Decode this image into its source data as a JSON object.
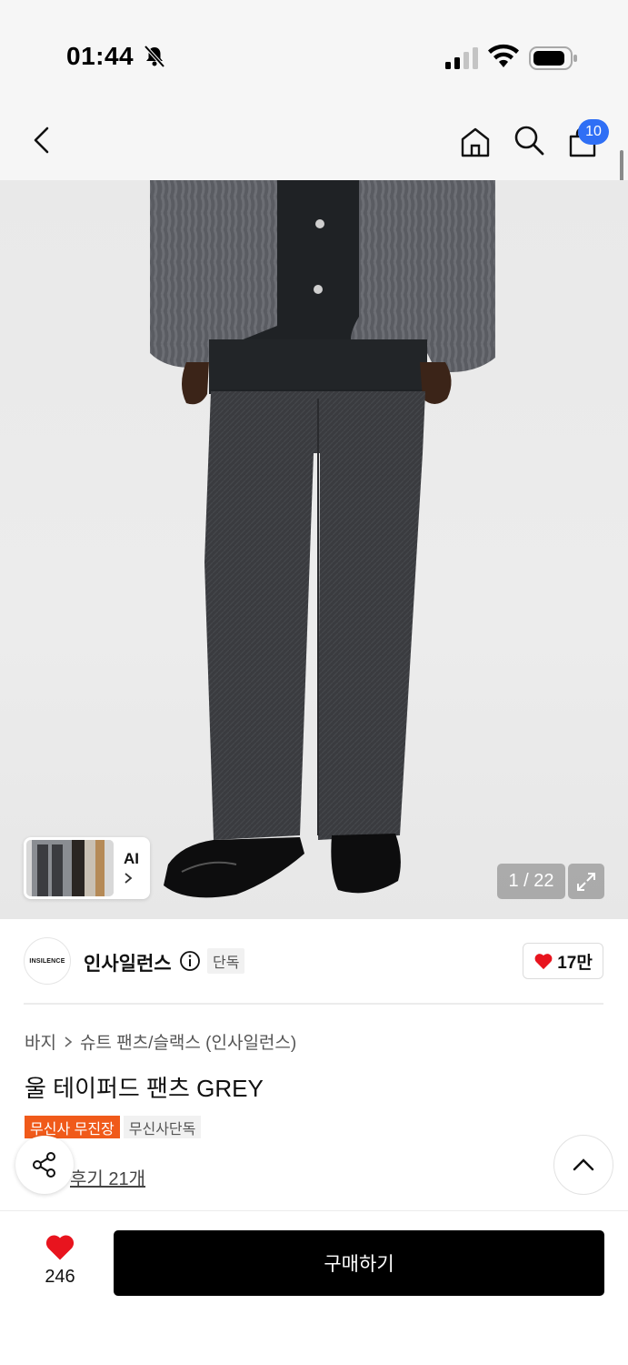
{
  "status_bar": {
    "time": "01:44",
    "icons": [
      "bell-muted-icon",
      "signal-icon",
      "wifi-icon",
      "battery-icon"
    ]
  },
  "nav": {
    "cart_count": "10",
    "icons": [
      "back-arrow-icon",
      "home-icon",
      "search-icon",
      "cart-icon"
    ]
  },
  "gallery": {
    "counter": "1 / 22",
    "ai_label": "AI",
    "expand_icon": "expand-icon"
  },
  "brand": {
    "logo_text": "INSILENCE",
    "name": "인사일런스",
    "tag": "단독",
    "likes": "17만"
  },
  "product": {
    "breadcrumb": [
      "바지",
      "슈트 팬츠/슬랙스 (인사일런스)"
    ],
    "title": "울 테이퍼드 팬츠 GREY",
    "badges": [
      "무신사 무진장",
      "무신사단독"
    ],
    "reviews": "후기 21개"
  },
  "bottom_bar": {
    "like_count": "246",
    "buy_label": "구매하기"
  },
  "colors": {
    "accent_blue": "#2f6ff5",
    "badge_orange": "#f05a1a",
    "heart_red": "#e8141e",
    "buy_button": "#000000"
  }
}
